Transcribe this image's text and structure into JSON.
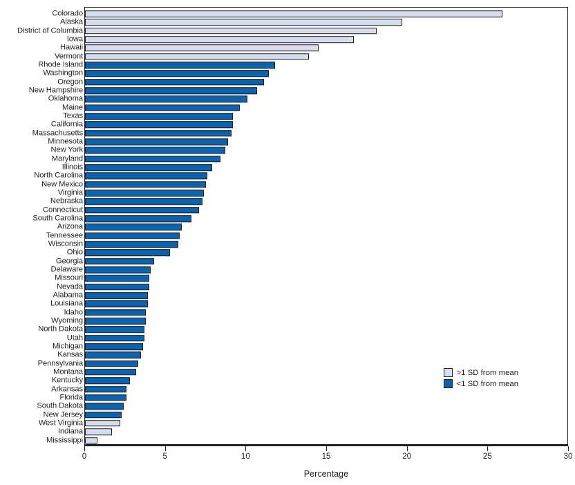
{
  "chart_data": {
    "type": "bar",
    "orientation": "horizontal",
    "title": "",
    "xlabel": "Percentage",
    "ylabel": "",
    "xlim": [
      0,
      30
    ],
    "xticks": [
      0,
      5,
      10,
      15,
      20,
      25,
      30
    ],
    "grid": false,
    "legend_position": "middle-right",
    "legend": [
      {
        "label": ">1 SD from mean",
        "color": "#d6ddee",
        "key": "high"
      },
      {
        "label": "<1 SD from mean",
        "color": "#0b62ad",
        "key": "low"
      }
    ],
    "categories": [
      "Colorado",
      "Alaska",
      "District of Columbia",
      "Iowa",
      "Hawaii",
      "Vermont",
      "Rhode Island",
      "Washington",
      "Oregon",
      "New Hampshire",
      "Oklahoma",
      "Maine",
      "Texas",
      "California",
      "Massachusetts",
      "Minnesota",
      "New York",
      "Maryland",
      "Illinois",
      "North Carolina",
      "New Mexico",
      "Virginia",
      "Nebraska",
      "Connecticut",
      "South Carolina",
      "Arizona",
      "Tennessee",
      "Wisconsin",
      "Ohio",
      "Georgia",
      "Delaware",
      "Missouri",
      "Nevada",
      "Alabama",
      "Louisiana",
      "Idaho",
      "Wyoming",
      "North Dakota",
      "Utah",
      "Michigan",
      "Kansas",
      "Pennsylvania",
      "Montana",
      "Kentucky",
      "Arkansas",
      "Florida",
      "South Dakota",
      "New Jersey",
      "West Virginia",
      "Indiana",
      "Mississippi"
    ],
    "values": [
      25.8,
      19.6,
      18.0,
      16.6,
      14.4,
      13.8,
      11.7,
      11.3,
      11.0,
      10.6,
      10.0,
      9.5,
      9.1,
      9.1,
      9.0,
      8.8,
      8.6,
      8.3,
      7.8,
      7.5,
      7.4,
      7.3,
      7.2,
      7.0,
      6.5,
      5.9,
      5.8,
      5.7,
      5.2,
      4.2,
      4.0,
      3.9,
      3.9,
      3.8,
      3.8,
      3.7,
      3.7,
      3.6,
      3.6,
      3.5,
      3.4,
      3.2,
      3.1,
      2.7,
      2.5,
      2.5,
      2.3,
      2.2,
      2.1,
      1.6,
      0.7
    ],
    "series_keys": [
      "high",
      "high",
      "high",
      "high",
      "high",
      "high",
      "low",
      "low",
      "low",
      "low",
      "low",
      "low",
      "low",
      "low",
      "low",
      "low",
      "low",
      "low",
      "low",
      "low",
      "low",
      "low",
      "low",
      "low",
      "low",
      "low",
      "low",
      "low",
      "low",
      "low",
      "low",
      "low",
      "low",
      "low",
      "low",
      "low",
      "low",
      "low",
      "low",
      "low",
      "low",
      "low",
      "low",
      "low",
      "low",
      "low",
      "low",
      "low",
      "high",
      "high",
      "high"
    ]
  }
}
